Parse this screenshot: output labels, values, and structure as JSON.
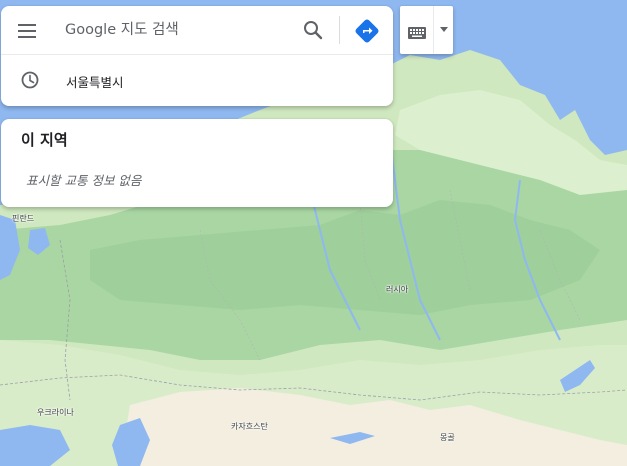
{
  "search": {
    "placeholder": "Google 지도 검색",
    "menu_icon": "menu-icon",
    "search_icon": "search-icon",
    "directions_icon": "directions-icon"
  },
  "history": {
    "items": [
      {
        "label": "서울특별시",
        "icon": "clock-icon"
      }
    ]
  },
  "area": {
    "title": "이 지역",
    "empty_message": "표시할 교통 정보 없음"
  },
  "keyboard": {
    "icon": "keyboard-icon",
    "dropdown_icon": "chevron-down-icon"
  },
  "map": {
    "labels": {
      "finland": "핀란드",
      "russia": "러시아",
      "ukraine": "우크라이나",
      "kazakhstan": "카자흐스탄",
      "mongolia": "몽골"
    },
    "colors": {
      "water": "#8fb8f0",
      "forest": "#a8d5a2",
      "land": "#d6ecc4",
      "desert": "#f4efe2",
      "accent": "#1a73e8"
    }
  }
}
